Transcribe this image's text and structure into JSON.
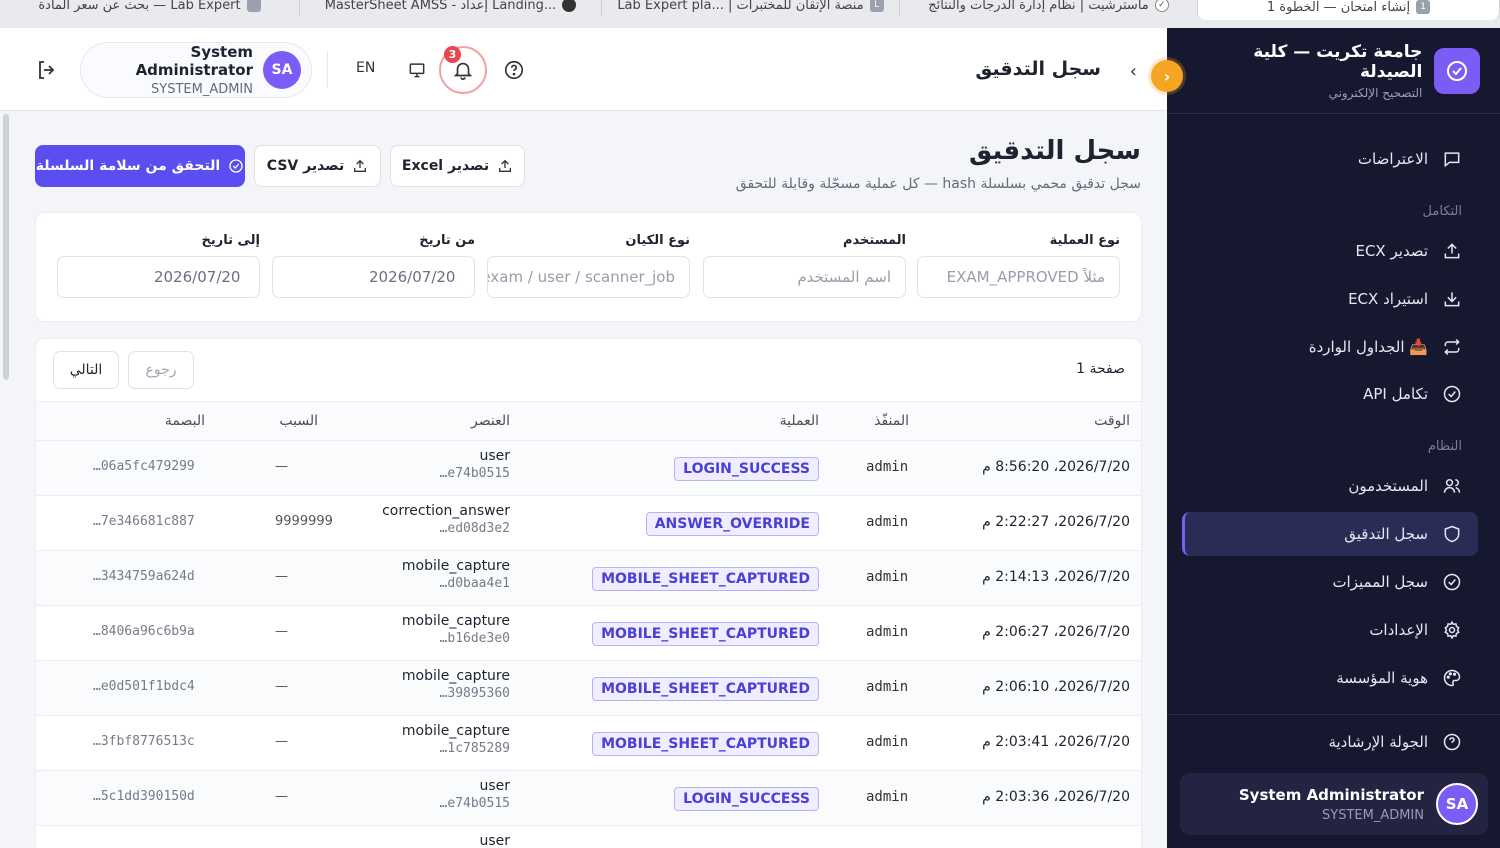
{
  "browser_tabs": [
    {
      "label": "بحث عن سعر المادة — Lab Expert",
      "icon": "tab-favicon"
    },
    {
      "label": "MasterSheet AMSS - إعداد Landing...",
      "icon": "openai-icon"
    },
    {
      "label": "Lab Expert pla... | منصة الإتقان للمختبرات",
      "icon": "L"
    },
    {
      "label": "ماسترشيت | نظام إدارة الدرجات والنتائج",
      "icon": "check-icon"
    },
    {
      "label": "إنشاء امتحان — الخطوة 1",
      "icon": "1"
    }
  ],
  "sidebar": {
    "brand_title": "جامعة تكريت — كلية الصيدلة",
    "brand_subtitle": "التصحيح الإلكتروني",
    "items": [
      {
        "label": "الاعتراضات",
        "icon": "message-icon"
      },
      {
        "label": "تصدير ECX",
        "icon": "upload-icon"
      },
      {
        "label": "استيراد ECX",
        "icon": "download-icon"
      },
      {
        "label": "📥 الجداول الواردة",
        "icon": "repeat-icon"
      },
      {
        "label": "تكامل API",
        "icon": "check-circle-icon"
      },
      {
        "label": "المستخدمون",
        "icon": "users-icon"
      },
      {
        "label": "سجل التدقيق",
        "icon": "shield-icon"
      },
      {
        "label": "سجل المميزات",
        "icon": "check-circle-icon"
      },
      {
        "label": "الإعدادات",
        "icon": "gear-icon"
      },
      {
        "label": "هوية المؤسسة",
        "icon": "palette-icon"
      },
      {
        "label": "الجولة الإرشادية",
        "icon": "help-icon"
      }
    ],
    "sections": {
      "integration": "التكامل",
      "system": "النظام"
    },
    "user": {
      "name": "System Administrator",
      "role": "SYSTEM_ADMIN",
      "initials": "SA"
    }
  },
  "topbar": {
    "title": "سجل التدقيق",
    "lang": "EN",
    "notifications_count": "3",
    "user": {
      "name": "System Administrator",
      "role": "SYSTEM_ADMIN",
      "initials": "SA"
    }
  },
  "page": {
    "title": "سجل التدقيق",
    "subtitle": "سجل تدقيق محمي بسلسلة hash — كل عملية مسجّلة وقابلة للتحقق",
    "btn_verify": "التحقق من سلامة السلسلة",
    "btn_csv": "تصدير CSV",
    "btn_excel": "تصدير Excel"
  },
  "filters": {
    "operation_type": {
      "label": "نوع العملية",
      "placeholder": "مثلاً EXAM_APPROVED"
    },
    "user": {
      "label": "المستخدم",
      "placeholder": "اسم المستخدم"
    },
    "entity_type": {
      "label": "نوع الكيان",
      "placeholder": "exam / user / scanner_job"
    },
    "from_date": {
      "label": "من تاريخ",
      "value": "2026/07/20"
    },
    "to_date": {
      "label": "إلى تاريخ",
      "value": "2026/07/20"
    }
  },
  "table": {
    "page_indicator": "صفحة 1",
    "prev_label": "رجوع",
    "next_label": "التالي",
    "columns": {
      "time": "الوقت",
      "actor": "المنفّذ",
      "operation": "العملية",
      "element": "العنصر",
      "reason": "السبب",
      "fingerprint": "البصمة"
    },
    "rows": [
      {
        "time": "2026/7/20، 8:56:20 م",
        "actor": "admin",
        "operation": "LOGIN_SUCCESS",
        "element": "user",
        "element_id": "…e74b0515",
        "reason": "—",
        "fingerprint": "…06a5fc479299"
      },
      {
        "time": "2026/7/20، 2:22:27 م",
        "actor": "admin",
        "operation": "ANSWER_OVERRIDE",
        "element": "correction_answer",
        "element_id": "…ed08d3e2",
        "reason": "9999999",
        "fingerprint": "…7e346681c887"
      },
      {
        "time": "2026/7/20، 2:14:13 م",
        "actor": "admin",
        "operation": "MOBILE_SHEET_CAPTURED",
        "element": "mobile_capture",
        "element_id": "…d0baa4e1",
        "reason": "—",
        "fingerprint": "…3434759a624d"
      },
      {
        "time": "2026/7/20، 2:06:27 م",
        "actor": "admin",
        "operation": "MOBILE_SHEET_CAPTURED",
        "element": "mobile_capture",
        "element_id": "…b16de3e0",
        "reason": "—",
        "fingerprint": "…8406a96c6b9a"
      },
      {
        "time": "2026/7/20، 2:06:10 م",
        "actor": "admin",
        "operation": "MOBILE_SHEET_CAPTURED",
        "element": "mobile_capture",
        "element_id": "…39895360",
        "reason": "—",
        "fingerprint": "…e0d501f1bdc4"
      },
      {
        "time": "2026/7/20، 2:03:41 م",
        "actor": "admin",
        "operation": "MOBILE_SHEET_CAPTURED",
        "element": "mobile_capture",
        "element_id": "…1c785289",
        "reason": "—",
        "fingerprint": "…3fbf8776513c"
      },
      {
        "time": "2026/7/20، 2:03:36 م",
        "actor": "admin",
        "operation": "LOGIN_SUCCESS",
        "element": "user",
        "element_id": "…e74b0515",
        "reason": "—",
        "fingerprint": "…5c1dd390150d"
      },
      {
        "time": "",
        "actor": "",
        "operation": "",
        "element": "user",
        "element_id": "",
        "reason": "",
        "fingerprint": ""
      }
    ]
  },
  "colors": {
    "accent": "#5a4ef0",
    "sidebar_bg": "#161830",
    "badge": "#e5484d",
    "collapse": "#f5a524"
  }
}
